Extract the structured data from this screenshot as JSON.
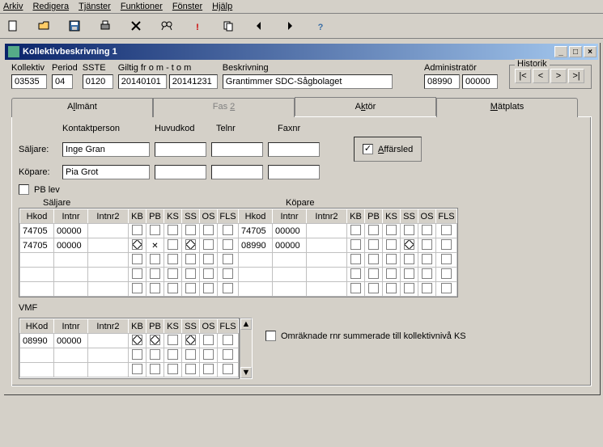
{
  "menu": {
    "arkiv": "Arkiv",
    "redigera": "Redigera",
    "tjanster": "Tjänster",
    "funktioner": "Funktioner",
    "fonster": "Fönster",
    "hjalp": "Hjälp"
  },
  "window_title": "Kollektivbeskrivning 1",
  "header": {
    "kollektiv_lbl": "Kollektiv",
    "kollektiv": "03535",
    "period_lbl": "Period",
    "period": "04",
    "sste_lbl": "SSTE",
    "sste": "0120",
    "giltig_lbl": "Giltig fr o m - t o m",
    "giltig_from": "20140101",
    "giltig_tom": "20141231",
    "beskr_lbl": "Beskrivning",
    "beskr": "Grantimmer SDC-Sågbolaget",
    "admin_lbl": "Administratör",
    "admin1": "08990",
    "admin2": "00000",
    "historik_lbl": "Historik"
  },
  "tabs": {
    "allmant": "Allmänt",
    "fas2": "Fas 2",
    "aktor": "Aktör",
    "matplats": "Mätplats"
  },
  "aktor": {
    "kontaktperson_lbl": "Kontaktperson",
    "huvudkod_lbl": "Huvudkod",
    "telnr_lbl": "Telnr",
    "faxnr_lbl": "Faxnr",
    "saljare_lbl": "Säljare:",
    "saljare_namn": "Inge Gran",
    "kopare_lbl": "Köpare:",
    "kopare_namn": "Pia Grot",
    "affarsled": "Affärsled",
    "pb_lev": "PB lev",
    "grid_saljare_lbl": "Säljare",
    "grid_kopare_lbl": "Köpare",
    "cols": {
      "hkod": "Hkod",
      "intnr": "Intnr",
      "intnr2": "Intnr2",
      "kb": "KB",
      "pb": "PB",
      "ks": "KS",
      "ss": "SS",
      "os": "OS",
      "fls": "FLS"
    },
    "rows": [
      {
        "s_hkod": "74705",
        "s_intnr": "00000",
        "s_intnr2": "",
        "s_kb": false,
        "s_pb": false,
        "s_ks": false,
        "s_ss": false,
        "s_os": false,
        "s_fls": false,
        "k_hkod": "74705",
        "k_intnr": "00000",
        "k_intnr2": "",
        "k_kb": false,
        "k_pb": false,
        "k_ks": false,
        "k_ss": false,
        "k_os": false,
        "k_fls": false
      },
      {
        "s_hkod": "74705",
        "s_intnr": "00000",
        "s_intnr2": "",
        "s_kb": true,
        "s_pb": "x",
        "s_ks": false,
        "s_ss": true,
        "s_os": false,
        "s_fls": false,
        "k_hkod": "08990",
        "k_intnr": "00000",
        "k_intnr2": "",
        "k_kb": false,
        "k_pb": false,
        "k_ks": false,
        "k_ss": true,
        "k_os": false,
        "k_fls": false
      },
      {
        "s_hkod": "",
        "s_intnr": "",
        "s_intnr2": "",
        "s_kb": false,
        "s_pb": false,
        "s_ks": false,
        "s_ss": false,
        "s_os": false,
        "s_fls": false,
        "k_hkod": "",
        "k_intnr": "",
        "k_intnr2": "",
        "k_kb": false,
        "k_pb": false,
        "k_ks": false,
        "k_ss": false,
        "k_os": false,
        "k_fls": false
      },
      {
        "s_hkod": "",
        "s_intnr": "",
        "s_intnr2": "",
        "s_kb": false,
        "s_pb": false,
        "s_ks": false,
        "s_ss": false,
        "s_os": false,
        "s_fls": false,
        "k_hkod": "",
        "k_intnr": "",
        "k_intnr2": "",
        "k_kb": false,
        "k_pb": false,
        "k_ks": false,
        "k_ss": false,
        "k_os": false,
        "k_fls": false
      },
      {
        "s_hkod": "",
        "s_intnr": "",
        "s_intnr2": "",
        "s_kb": false,
        "s_pb": false,
        "s_ks": false,
        "s_ss": false,
        "s_os": false,
        "s_fls": false,
        "k_hkod": "",
        "k_intnr": "",
        "k_intnr2": "",
        "k_kb": false,
        "k_pb": false,
        "k_ks": false,
        "k_ss": false,
        "k_os": false,
        "k_fls": false
      }
    ],
    "vmf_lbl": "VMF",
    "vmf_cols": {
      "hkod": "HKod",
      "intnr": "Intnr",
      "intnr2": "Intnr2",
      "kb": "KB",
      "pb": "PB",
      "ks": "KS",
      "ss": "SS",
      "os": "OS",
      "fls": "FLS"
    },
    "vmf_rows": [
      {
        "hkod": "08990",
        "intnr": "00000",
        "intnr2": "",
        "kb": true,
        "pb": true,
        "ks": false,
        "ss": true,
        "os": false,
        "fls": false
      },
      {
        "hkod": "",
        "intnr": "",
        "intnr2": "",
        "kb": false,
        "pb": false,
        "ks": false,
        "ss": false,
        "os": false,
        "fls": false
      },
      {
        "hkod": "",
        "intnr": "",
        "intnr2": "",
        "kb": false,
        "pb": false,
        "ks": false,
        "ss": false,
        "os": false,
        "fls": false
      }
    ],
    "omraknade": "Omräknade rnr summerade till kollektivnivå KS"
  }
}
